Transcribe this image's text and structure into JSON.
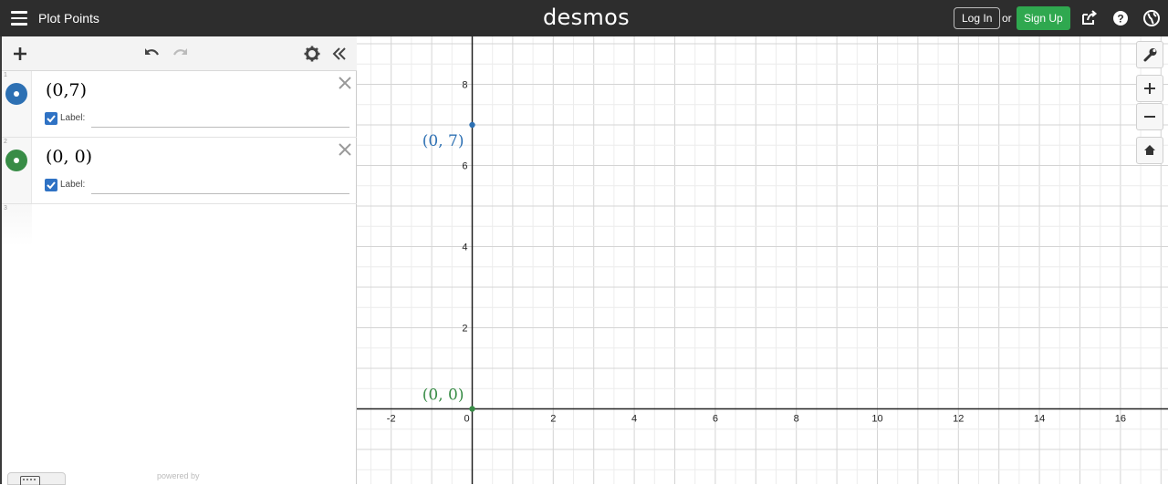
{
  "header": {
    "title": "Plot Points",
    "logo": "desmos",
    "login_label": "Log In",
    "or_text": "or",
    "signup_label": "Sign Up"
  },
  "expressions": [
    {
      "index": "1",
      "text": "(0,7)",
      "color": "#2d70b3",
      "label_caption": "Label:",
      "label_checked": true
    },
    {
      "index": "2",
      "text": "(0, 0)",
      "color": "#388c46",
      "label_caption": "Label:",
      "label_checked": true
    },
    {
      "index": "3"
    }
  ],
  "footer": {
    "powered_by": "powered by"
  },
  "graph": {
    "x_ticks": [
      "-2",
      "0",
      "2",
      "4",
      "6",
      "8",
      "10",
      "12",
      "14",
      "16"
    ],
    "y_ticks": [
      "2",
      "4",
      "6",
      "8"
    ],
    "points": [
      {
        "label": "(0, 7)",
        "x": 0,
        "y": 7,
        "color": "#2d70b3"
      },
      {
        "label": "(0, 0)",
        "x": 0,
        "y": 0,
        "color": "#388c46"
      }
    ]
  }
}
